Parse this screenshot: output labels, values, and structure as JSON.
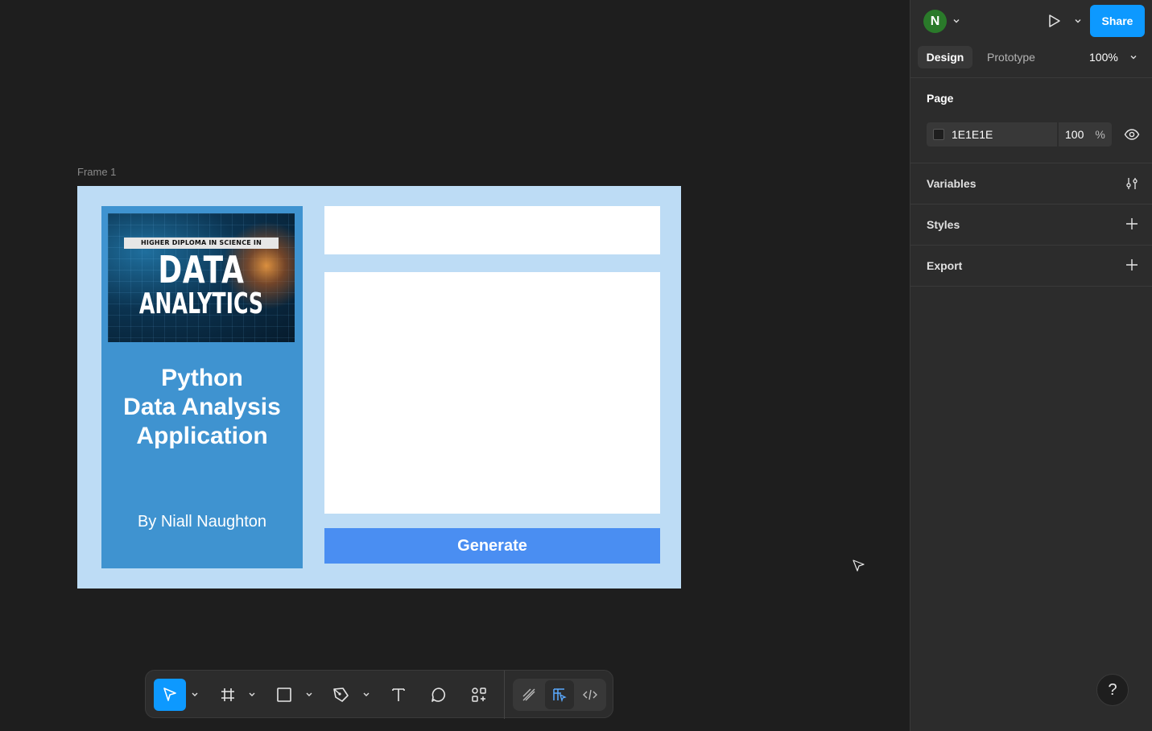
{
  "canvas": {
    "frame_label": "Frame 1",
    "colors": {
      "canvas_bg": "#1e1e1e",
      "frame_bg": "#bddcf5",
      "card_bg": "#3f93d0",
      "button_bg": "#4a8ef2"
    }
  },
  "app": {
    "cover": {
      "banner": "HIGHER DIPLOMA IN SCIENCE IN",
      "title_line1": "DATA",
      "title_line2": "ANALYTICS"
    },
    "title_line1": "Python",
    "title_line2": "Data Analysis",
    "title_line3": "Application",
    "author": "By Niall Naughton",
    "generate_label": "Generate"
  },
  "toolbar": {
    "tools": [
      "move-tool",
      "frame-tool",
      "shape-tool",
      "pen-tool",
      "text-tool",
      "comment-tool",
      "actions-tool"
    ],
    "modes": [
      "draw-mode",
      "design-mode",
      "dev-mode"
    ],
    "active_tool": "move-tool",
    "active_mode": "design-mode"
  },
  "panel": {
    "avatar_initial": "N",
    "share_label": "Share",
    "tabs": {
      "design": "Design",
      "prototype": "Prototype"
    },
    "zoom": "100%",
    "page": {
      "title": "Page",
      "color_hex": "1E1E1E",
      "opacity": "100",
      "opacity_unit": "%"
    },
    "sections": {
      "variables": "Variables",
      "styles": "Styles",
      "export": "Export"
    },
    "help_label": "?"
  }
}
